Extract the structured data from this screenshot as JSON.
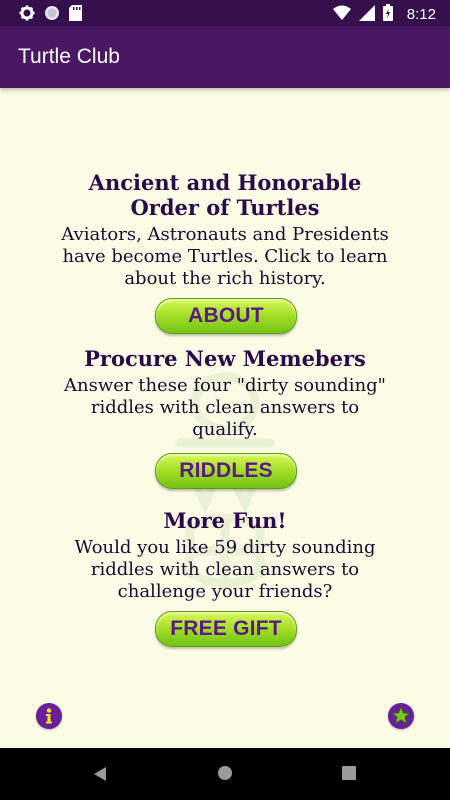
{
  "status_bar": {
    "time": "8:12",
    "icons": [
      "settings-icon",
      "circle-icon",
      "sd-card-icon",
      "wifi-icon",
      "signal-icon",
      "battery-icon"
    ]
  },
  "app_bar": {
    "title": "Turtle Club"
  },
  "sections": {
    "about": {
      "heading": "Ancient and Honorable\nOrder of Turtles",
      "body": "Aviators, Astronauts and Presidents have become Turtles. Click to learn about the rich history.",
      "button_label": "ABOUT"
    },
    "riddles": {
      "heading": "Procure New Memebers",
      "body": "Answer these four \"dirty sounding\" riddles with clean answers to qualify.",
      "button_label": "RIDDLES"
    },
    "fun": {
      "heading": "More Fun!",
      "body": "Would you like 59 dirty sounding riddles with clean answers to challenge your friends?",
      "button_label": "FREE GIFT"
    }
  },
  "bottom_icons": {
    "left": "info-icon",
    "right": "star-icon"
  },
  "nav_bar": {
    "icons": [
      "back-icon",
      "home-icon",
      "recents-icon"
    ]
  },
  "colors": {
    "status_bar": "#35104c",
    "app_bar": "#4a1763",
    "background": "#fcfce6",
    "heading_text": "#2c0a4a",
    "button_green": "#a7e02a",
    "button_text": "#5a1a82",
    "icon_purple": "#6a1f9a"
  }
}
